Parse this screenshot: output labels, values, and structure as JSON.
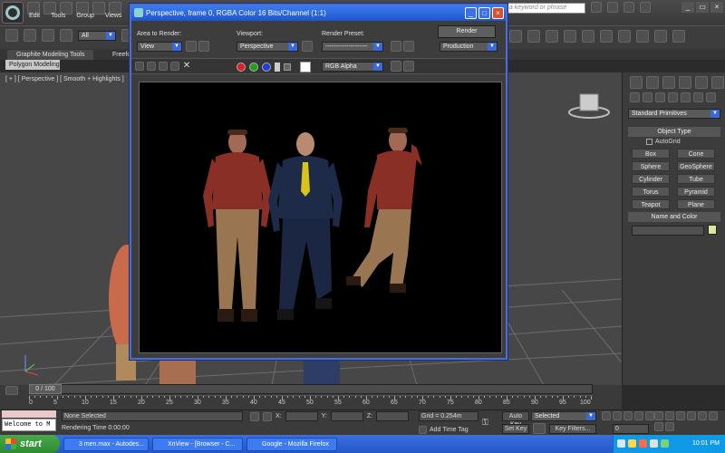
{
  "menu": [
    "Edit",
    "Tools",
    "Group",
    "Views"
  ],
  "search_placeholder": "e a keyword or phrase",
  "toolbar": {
    "selection_filter": "All"
  },
  "ribbon": {
    "tab1": "Graphite Modeling Tools",
    "tab2": "Freefo",
    "poly_tab": "Polygon Modeling"
  },
  "viewport": {
    "label": "[ + ] [ Perspective ] [ Smooth + Highlights ]"
  },
  "render_window": {
    "title": "Perspective, frame 0, RGBA Color 16 Bits/Channel (1:1)",
    "area_label": "Area to Render:",
    "area_value": "View",
    "viewport_label": "Viewport:",
    "viewport_value": "Perspective",
    "preset_label": "Render Preset:",
    "preset_value": "--------------------",
    "render_button": "Render",
    "production_value": "Production",
    "channel_value": "RGB Alpha"
  },
  "command_panel": {
    "category": "Standard Primitives",
    "object_type_header": "Object Type",
    "autogrid": "AutoGrid",
    "buttons": [
      "Box",
      "Cone",
      "Sphere",
      "GeoSphere",
      "Cylinder",
      "Tube",
      "Torus",
      "Pyramid",
      "Teapot",
      "Plane"
    ],
    "name_color_header": "Name and Color",
    "color_swatch": "#d9e89a"
  },
  "timeline": {
    "frame_label": "0 / 100",
    "ticks": [
      "0",
      "5",
      "10",
      "15",
      "20",
      "25",
      "30",
      "35",
      "40",
      "45",
      "50",
      "55",
      "60",
      "65",
      "70",
      "75",
      "80",
      "85",
      "90",
      "95",
      "100"
    ]
  },
  "status": {
    "welcome": "Welcome to M",
    "selection": "None Selected",
    "render_time": "Rendering Time  0:00:00",
    "x_label": "X:",
    "y_label": "Y:",
    "z_label": "Z:",
    "grid": "Grid = 0.254m",
    "add_time_tag": "Add Time Tag",
    "auto_key": "Auto Key",
    "auto_key_value": "Selected",
    "set_key": "Set Key",
    "key_filters": "Key Filters...",
    "frame_value": "0"
  },
  "taskbar": {
    "start": "start",
    "tasks": [
      "3 men.max - Autodes...",
      "XnView - [Browser - C...",
      "Google - Mozilla Firefox"
    ],
    "clock": "10:01 PM"
  }
}
